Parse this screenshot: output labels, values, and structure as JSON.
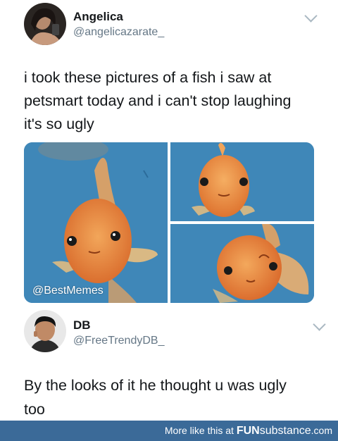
{
  "tweet1": {
    "name": "Angelica",
    "handle": "@angelicazarate_",
    "text_lines": [
      "i took these pictures of a fish i saw at",
      "petsmart today and i can't stop laughing",
      "it's so ugly"
    ],
    "watermark": "@BestMemes"
  },
  "tweet2": {
    "name": "DB",
    "handle": "@FreeTrendyDB_",
    "text_lines": [
      "By the looks of it he thought u was ugly",
      "too"
    ]
  },
  "footer": {
    "prefix": "More like this at",
    "brand_bold": "FUN",
    "brand_rest": "substance",
    "brand_tld": ".com"
  },
  "icons": {
    "menu": "chevron-down-icon",
    "fish": "goldfish-photo"
  },
  "colors": {
    "footer_bg": "#3b6a98",
    "water": "#3f87b8",
    "fish": "#e8833a"
  }
}
